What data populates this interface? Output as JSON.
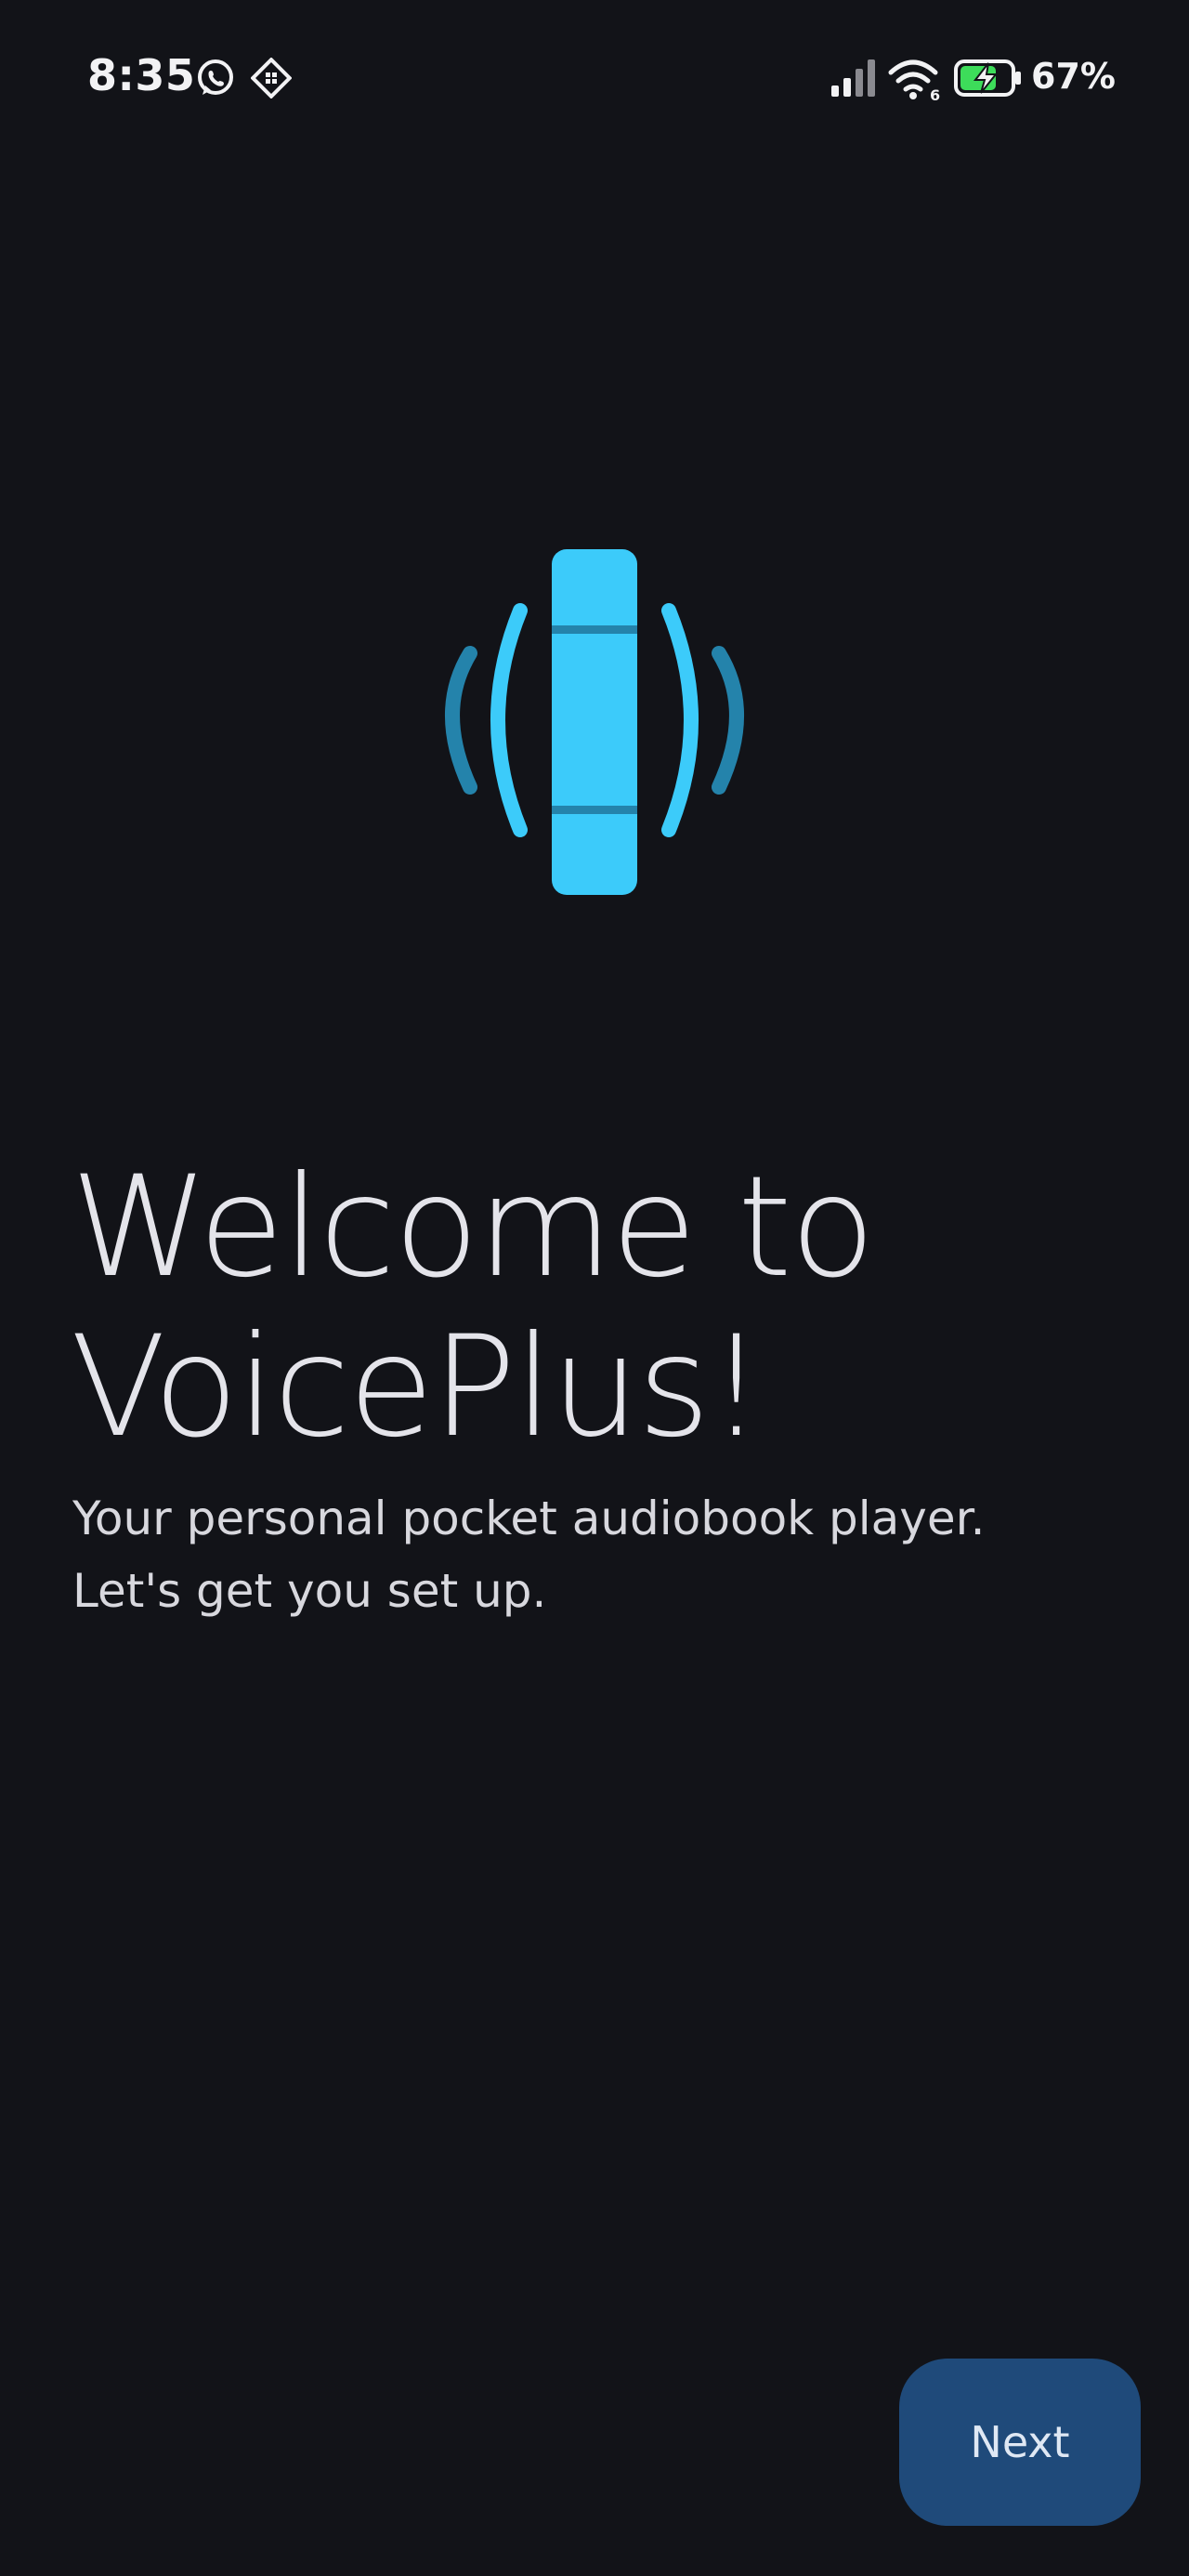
{
  "status_bar": {
    "time": "8:35",
    "notification_icons": [
      "whatsapp-icon",
      "app-notification-icon"
    ],
    "system_icons": [
      "cellular-signal-icon",
      "wifi-6-icon",
      "battery-charging-icon"
    ],
    "battery_percent": "67%"
  },
  "logo": {
    "icon": "voiceplus-logo-icon",
    "colors": {
      "primary": "#3ccbfa",
      "secondary": "#2483ab"
    }
  },
  "welcome": {
    "title": "Welcome to VoicePlus!",
    "subtitle_line1": "Your personal pocket audiobook player.",
    "subtitle_line2": "Let's get you set up."
  },
  "actions": {
    "next_label": "Next"
  },
  "colors": {
    "background": "#121318",
    "button_bg": "#1f4a7a",
    "text": "#e4e4ea"
  }
}
